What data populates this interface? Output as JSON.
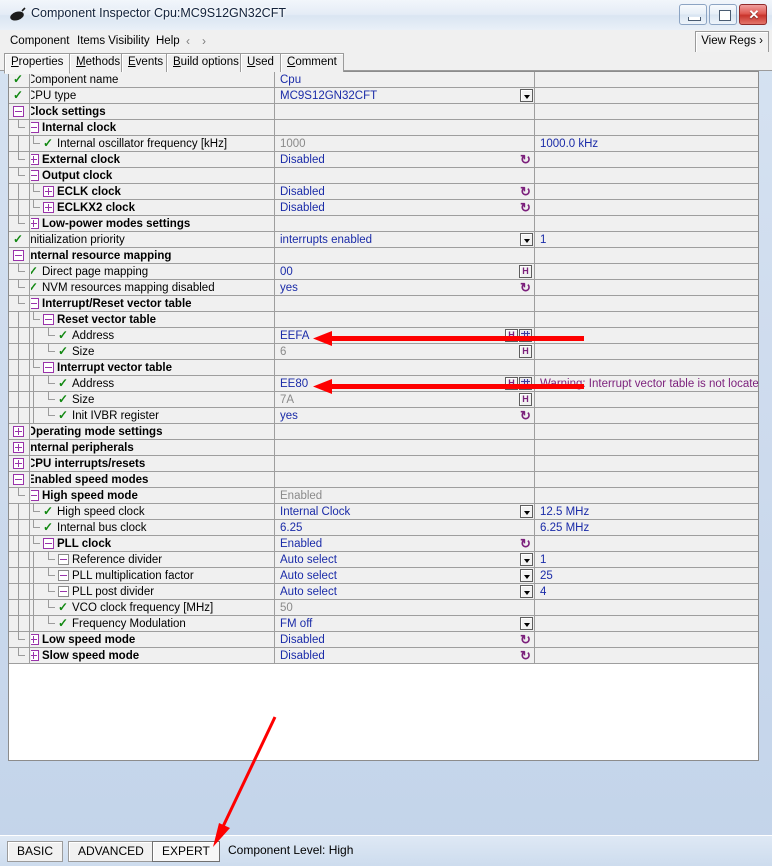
{
  "window": {
    "title": "Component Inspector Cpu:MC9S12GN32CFT",
    "icon": "component-icon",
    "minimize_label": "–",
    "maximize_label": "□",
    "close_label": "✕"
  },
  "menu": {
    "items": [
      "Component",
      "Items Visibility",
      "Help"
    ],
    "nav_back": "‹",
    "nav_forward": "›",
    "view_regs": "View Regs ›"
  },
  "tabs": [
    {
      "label": "Properties",
      "accel": "P",
      "active": true
    },
    {
      "label": "Methods",
      "accel": "M",
      "active": false
    },
    {
      "label": "Events",
      "accel": "E",
      "active": false
    },
    {
      "label": "Build options",
      "accel": "B",
      "active": false
    },
    {
      "label": "Used",
      "accel": "U",
      "active": false
    },
    {
      "label": "Comment",
      "accel": "C",
      "active": false
    }
  ],
  "colors": {
    "value_blue": "#1a2ba8",
    "readonly_grey": "#8a8a8a",
    "warning_purple": "#7b1f7b",
    "expander_purple": "#9933aa",
    "tick_green": "#118811",
    "annotation_red": "#fe0000"
  },
  "tree": {
    "rows": [
      {
        "indent": 0,
        "marker": "tick",
        "label": "Component name",
        "bold": false,
        "value": "Cpu",
        "value_style": "blue",
        "widget": "none",
        "col3": ""
      },
      {
        "indent": 0,
        "marker": "tick",
        "label": "CPU type",
        "bold": false,
        "value": "MC9S12GN32CFT",
        "value_style": "blue",
        "widget": "combo",
        "col3": ""
      },
      {
        "indent": 0,
        "marker": "minus",
        "label": "Clock settings",
        "bold": true,
        "value": "",
        "value_style": "blue",
        "widget": "none",
        "col3": ""
      },
      {
        "indent": 1,
        "marker": "minus",
        "label": "Internal clock",
        "bold": true,
        "value": "",
        "value_style": "blue",
        "widget": "none",
        "col3": ""
      },
      {
        "indent": 2,
        "marker": "tick",
        "label": "Internal oscillator frequency [kHz]",
        "bold": false,
        "value": "1000",
        "value_style": "grey",
        "widget": "none",
        "col3": "1000.0 kHz"
      },
      {
        "indent": 1,
        "marker": "plus",
        "label": "External clock",
        "bold": true,
        "value": "Disabled",
        "value_style": "blue",
        "widget": "reset",
        "col3": ""
      },
      {
        "indent": 1,
        "marker": "minus",
        "label": "Output clock",
        "bold": true,
        "value": "",
        "value_style": "blue",
        "widget": "none",
        "col3": ""
      },
      {
        "indent": 2,
        "marker": "plus",
        "label": "ECLK clock",
        "bold": true,
        "value": "Disabled",
        "value_style": "blue",
        "widget": "reset",
        "col3": ""
      },
      {
        "indent": 2,
        "marker": "plus",
        "label": "ECLKX2 clock",
        "bold": true,
        "value": "Disabled",
        "value_style": "blue",
        "widget": "reset",
        "col3": ""
      },
      {
        "indent": 1,
        "marker": "plus",
        "label": "Low-power modes settings",
        "bold": true,
        "value": "",
        "value_style": "blue",
        "widget": "none",
        "col3": ""
      },
      {
        "indent": 0,
        "marker": "tick",
        "label": "Initialization priority",
        "bold": false,
        "value": "interrupts enabled",
        "value_style": "blue",
        "widget": "combo",
        "col3": "1"
      },
      {
        "indent": 0,
        "marker": "minus",
        "label": "Internal resource mapping",
        "bold": true,
        "value": "",
        "value_style": "blue",
        "widget": "none",
        "col3": ""
      },
      {
        "indent": 1,
        "marker": "tick",
        "label": "Direct page mapping",
        "bold": false,
        "value": "00",
        "value_style": "blue",
        "widget": "hex",
        "col3": ""
      },
      {
        "indent": 1,
        "marker": "tick",
        "label": "NVM resources mapping disabled",
        "bold": false,
        "value": "yes",
        "value_style": "blue",
        "widget": "reset",
        "col3": ""
      },
      {
        "indent": 1,
        "marker": "minus",
        "label": "Interrupt/Reset vector table",
        "bold": true,
        "value": "",
        "value_style": "blue",
        "widget": "none",
        "col3": ""
      },
      {
        "indent": 2,
        "marker": "minus",
        "label": "Reset vector table",
        "bold": true,
        "value": "",
        "value_style": "blue",
        "widget": "none",
        "col3": ""
      },
      {
        "indent": 3,
        "marker": "tick",
        "label": "Address",
        "bold": false,
        "value": "EEFA",
        "value_style": "blue",
        "widget": "hex-grid",
        "col3": ""
      },
      {
        "indent": 3,
        "marker": "tick",
        "label": "Size",
        "bold": false,
        "value": "6",
        "value_style": "grey",
        "widget": "hex",
        "col3": ""
      },
      {
        "indent": 2,
        "marker": "minus",
        "label": "Interrupt vector table",
        "bold": true,
        "value": "",
        "value_style": "blue",
        "widget": "none",
        "col3": ""
      },
      {
        "indent": 3,
        "marker": "tick",
        "label": "Address",
        "bold": false,
        "value": "EE80",
        "value_style": "blue",
        "widget": "hex-grid",
        "col3": "Warning: Interrupt vector table is not located on e",
        "col3_style": "warn"
      },
      {
        "indent": 3,
        "marker": "tick",
        "label": "Size",
        "bold": false,
        "value": "7A",
        "value_style": "grey",
        "widget": "hex",
        "col3": ""
      },
      {
        "indent": 3,
        "marker": "tick",
        "label": "Init IVBR register",
        "bold": false,
        "value": "yes",
        "value_style": "blue",
        "widget": "reset",
        "col3": ""
      },
      {
        "indent": 0,
        "marker": "plus",
        "label": "Operating mode settings",
        "bold": true,
        "value": "",
        "value_style": "blue",
        "widget": "none",
        "col3": ""
      },
      {
        "indent": 0,
        "marker": "plus",
        "label": "Internal peripherals",
        "bold": true,
        "value": "",
        "value_style": "blue",
        "widget": "none",
        "col3": ""
      },
      {
        "indent": 0,
        "marker": "plus",
        "label": "CPU interrupts/resets",
        "bold": true,
        "value": "",
        "value_style": "blue",
        "widget": "none",
        "col3": ""
      },
      {
        "indent": 0,
        "marker": "minus",
        "label": "Enabled speed modes",
        "bold": true,
        "value": "",
        "value_style": "blue",
        "widget": "none",
        "col3": ""
      },
      {
        "indent": 1,
        "marker": "minus",
        "label": "High speed mode",
        "bold": true,
        "value": "Enabled",
        "value_style": "grey",
        "widget": "none",
        "col3": ""
      },
      {
        "indent": 2,
        "marker": "tick",
        "label": "High speed clock",
        "bold": false,
        "value": "Internal Clock",
        "value_style": "blue",
        "widget": "combo",
        "col3": "12.5 MHz"
      },
      {
        "indent": 2,
        "marker": "tick",
        "label": "Internal bus clock",
        "bold": false,
        "value": "6.25",
        "value_style": "blue",
        "widget": "none",
        "col3": "6.25 MHz"
      },
      {
        "indent": 2,
        "marker": "minus",
        "label": "PLL clock",
        "bold": true,
        "value": "Enabled",
        "value_style": "blue",
        "widget": "reset",
        "col3": ""
      },
      {
        "indent": 3,
        "marker": "minus-plain",
        "label": "Reference divider",
        "bold": false,
        "value": "Auto select",
        "value_style": "blue",
        "widget": "combo",
        "col3": "1"
      },
      {
        "indent": 3,
        "marker": "minus-plain",
        "label": "PLL multiplication factor",
        "bold": false,
        "value": "Auto select",
        "value_style": "blue",
        "widget": "combo",
        "col3": "25"
      },
      {
        "indent": 3,
        "marker": "minus-plain",
        "label": "PLL post divider",
        "bold": false,
        "value": "Auto select",
        "value_style": "blue",
        "widget": "combo",
        "col3": "4"
      },
      {
        "indent": 3,
        "marker": "tick",
        "label": "VCO clock frequency [MHz]",
        "bold": false,
        "value": "50",
        "value_style": "grey",
        "widget": "none",
        "col3": ""
      },
      {
        "indent": 3,
        "marker": "tick",
        "label": "Frequency Modulation",
        "bold": false,
        "value": "FM off",
        "value_style": "blue",
        "widget": "combo",
        "col3": ""
      },
      {
        "indent": 1,
        "marker": "plus",
        "label": "Low speed mode",
        "bold": true,
        "value": "Disabled",
        "value_style": "blue",
        "widget": "reset",
        "col3": ""
      },
      {
        "indent": 1,
        "marker": "plus",
        "label": "Slow speed mode",
        "bold": true,
        "value": "Disabled",
        "value_style": "blue",
        "widget": "reset",
        "col3": ""
      }
    ]
  },
  "bottom": {
    "tabs": [
      {
        "label": "BASIC",
        "active": false
      },
      {
        "label": "ADVANCED",
        "active": false
      },
      {
        "label": "EXPERT",
        "active": true
      }
    ],
    "status": "Component Level: High"
  },
  "annotations": [
    {
      "name": "arrow-reset-vector-address",
      "type": "arrow-left"
    },
    {
      "name": "arrow-interrupt-vector-address",
      "type": "arrow-left"
    },
    {
      "name": "arrow-expert-tab",
      "type": "arrow-diagonal"
    }
  ]
}
